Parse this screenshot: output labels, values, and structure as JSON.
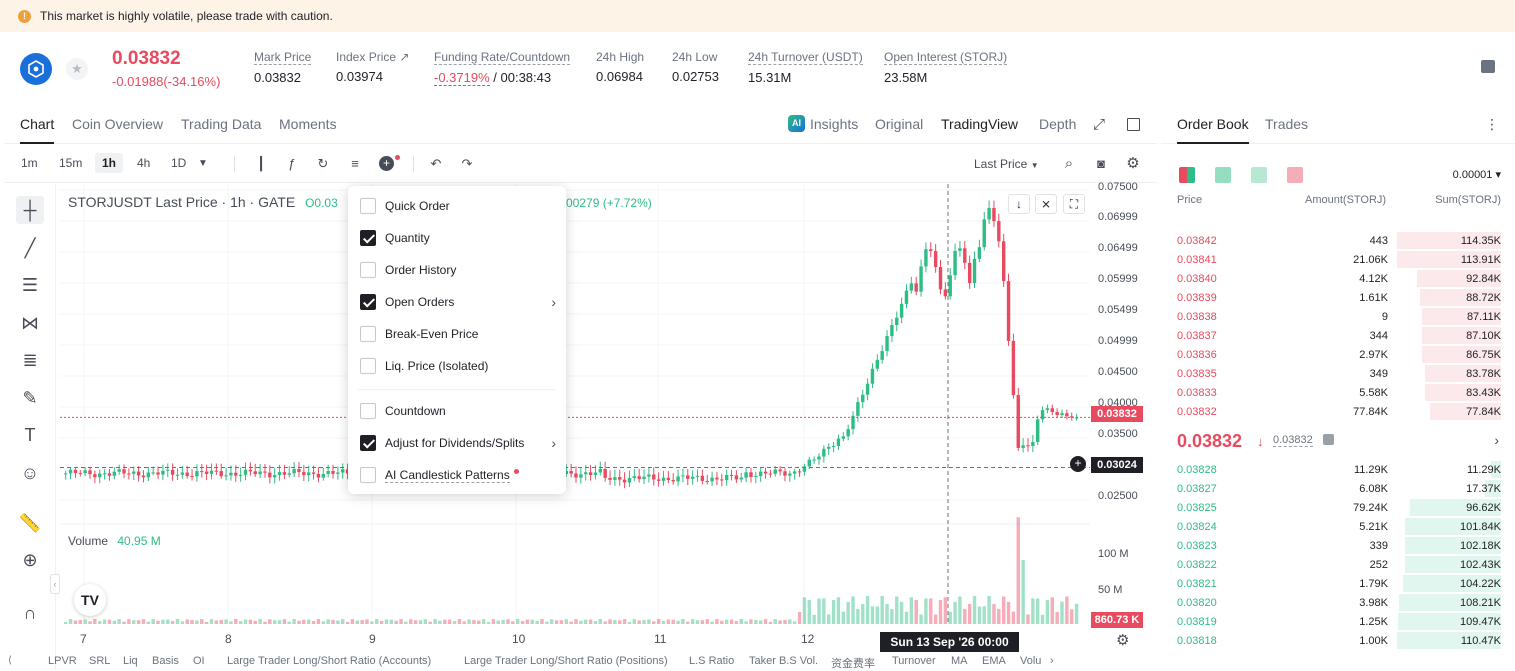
{
  "banner": {
    "text": "This market is highly volatile, please trade with caution.",
    "icon": "info-icon"
  },
  "ticker": {
    "last_price": "0.03832",
    "change": "-0.01988(-34.16%)",
    "stats": [
      {
        "label": "Mark Price",
        "value": "0.03832"
      },
      {
        "label": "Index Price ↗",
        "value": "0.03974"
      },
      {
        "label": "Funding Rate/Countdown",
        "value_red": "-0.3719%",
        "value": " / 00:38:43"
      },
      {
        "label": "24h High",
        "value": "0.06984"
      },
      {
        "label": "24h Low",
        "value": "0.02753"
      },
      {
        "label": "24h Turnover (USDT)",
        "value": "15.31M"
      },
      {
        "label": "Open Interest (STORJ)",
        "value": "23.58M"
      }
    ]
  },
  "chart_tabs": [
    "Chart",
    "Coin Overview",
    "Trading Data",
    "Moments"
  ],
  "chart_modes": {
    "insights": "Insights",
    "original": "Original",
    "tradingview": "TradingView",
    "depth": "Depth"
  },
  "timeframes": [
    "1m",
    "15m",
    "1h",
    "4h",
    "1D"
  ],
  "price_type": "Last Price",
  "legend": {
    "symbol": "STORJUSDT Last Price · 1h · GATE",
    "ohlc_prefix": "O0.03",
    "change": "00279 (+7.72%)"
  },
  "volume": {
    "label": "Volume",
    "value": "40.95 M"
  },
  "menu": [
    {
      "label": "Quick Order",
      "checked": false
    },
    {
      "label": "Quantity",
      "checked": true
    },
    {
      "label": "Order History",
      "checked": false
    },
    {
      "label": "Open Orders",
      "checked": true,
      "submenu": true
    },
    {
      "label": "Break-Even Price",
      "checked": false
    },
    {
      "label": "Liq. Price (Isolated)",
      "checked": false
    },
    {
      "label": "Countdown",
      "checked": false
    },
    {
      "label": "Adjust for Dividends/Splits",
      "checked": true,
      "submenu": true
    },
    {
      "label": "AI Candlestick Patterns",
      "checked": false
    }
  ],
  "price_axis": [
    "0.07500",
    "0.06999",
    "0.06499",
    "0.05999",
    "0.05499",
    "0.04999",
    "0.04500",
    "0.04000",
    "0.03500",
    "0.02500"
  ],
  "price_tag": "0.03832",
  "crosshair_tag": "0.03024",
  "volume_axis": [
    "100 M",
    "50 M"
  ],
  "volume_tag": "860.73 K",
  "x_axis": [
    "7",
    "8",
    "9",
    "10",
    "11",
    "12"
  ],
  "crosshair_time": "Sun 13 Sep '26   00:00",
  "indicators": [
    "LPVR",
    "SRL",
    "Liq",
    "Basis",
    "OI",
    "Large Trader Long/Short Ratio (Accounts)",
    "Large Trader Long/Short Ratio (Positions)",
    "L.S Ratio",
    "Taker B.S Vol.",
    "资金费率",
    "Turnover",
    "MA",
    "EMA",
    "Volu"
  ],
  "order_book": {
    "tabs": [
      "Order Book",
      "Trades"
    ],
    "precision": "0.00001 ▾",
    "headers": [
      "Price",
      "Amount(STORJ)",
      "Sum(STORJ)"
    ],
    "asks": [
      {
        "price": "0.03842",
        "amount": "443",
        "sum": "114.35K",
        "depth": 1.0
      },
      {
        "price": "0.03841",
        "amount": "21.06K",
        "sum": "113.91K",
        "depth": 0.996
      },
      {
        "price": "0.03840",
        "amount": "4.12K",
        "sum": "92.84K",
        "depth": 0.81
      },
      {
        "price": "0.03839",
        "amount": "1.61K",
        "sum": "88.72K",
        "depth": 0.776
      },
      {
        "price": "0.03838",
        "amount": "9",
        "sum": "87.11K",
        "depth": 0.762
      },
      {
        "price": "0.03837",
        "amount": "344",
        "sum": "87.10K",
        "depth": 0.762
      },
      {
        "price": "0.03836",
        "amount": "2.97K",
        "sum": "86.75K",
        "depth": 0.759
      },
      {
        "price": "0.03835",
        "amount": "349",
        "sum": "83.78K",
        "depth": 0.733
      },
      {
        "price": "0.03833",
        "amount": "5.58K",
        "sum": "83.43K",
        "depth": 0.73
      },
      {
        "price": "0.03832",
        "amount": "77.84K",
        "sum": "77.84K",
        "depth": 0.68
      }
    ],
    "mid_price": "0.03832",
    "mid_mark": "0.03832",
    "bids": [
      {
        "price": "0.03828",
        "amount": "11.29K",
        "sum": "11.29K",
        "depth": 0.1
      },
      {
        "price": "0.03827",
        "amount": "6.08K",
        "sum": "17.37K",
        "depth": 0.157
      },
      {
        "price": "0.03825",
        "amount": "79.24K",
        "sum": "96.62K",
        "depth": 0.873
      },
      {
        "price": "0.03824",
        "amount": "5.21K",
        "sum": "101.84K",
        "depth": 0.92
      },
      {
        "price": "0.03823",
        "amount": "339",
        "sum": "102.18K",
        "depth": 0.923
      },
      {
        "price": "0.03822",
        "amount": "252",
        "sum": "102.43K",
        "depth": 0.925
      },
      {
        "price": "0.03821",
        "amount": "1.79K",
        "sum": "104.22K",
        "depth": 0.941
      },
      {
        "price": "0.03820",
        "amount": "3.98K",
        "sum": "108.21K",
        "depth": 0.977
      },
      {
        "price": "0.03819",
        "amount": "1.25K",
        "sum": "109.47K",
        "depth": 0.989
      },
      {
        "price": "0.03818",
        "amount": "1.00K",
        "sum": "110.47K",
        "depth": 0.998
      }
    ]
  },
  "colors": {
    "up": "#2ebd85",
    "down": "#e84a5f",
    "text": "#1e2026",
    "muted": "#6b7280"
  }
}
